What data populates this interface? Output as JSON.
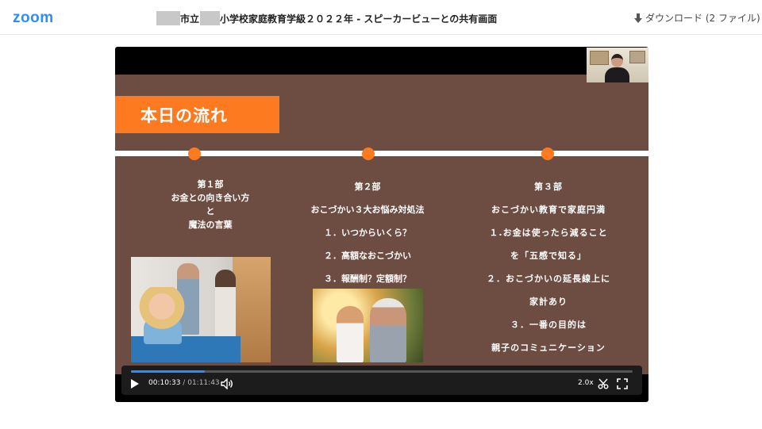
{
  "header": {
    "logo": "zoom",
    "title_part1": "市立",
    "title_part2": "小学校家庭教育学級２０２２年 - スピーカービューとの共有画面",
    "download_label": "ダウンロード (2 ファイル)",
    "download_icon": "download-arrow-icon"
  },
  "slide": {
    "title": "本日の流れ",
    "columns": [
      {
        "lines": [
          "第１部",
          "お金との向き合い方",
          "と",
          "魔法の言葉"
        ]
      },
      {
        "lines": [
          "第２部",
          "おこづかい３大お悩み対処法",
          "１．いつからいくら？",
          "２．高額なおこづかい",
          "３．報酬制？定額制？"
        ]
      },
      {
        "lines": [
          "第３部",
          "おこづかい教育で家庭円満",
          "１.お金は使ったら減ること",
          "を「五感で知る」",
          "２．おこづかいの延長線上に",
          "家計あり",
          "３．一番の目的は",
          "親子のコミュニケーション"
        ]
      }
    ],
    "accent_color": "#fe7a20",
    "background_color": "#6d4c42"
  },
  "player": {
    "current_time": "00:10:33",
    "separator": "/",
    "duration": "01:11:43",
    "progress_fraction": 0.147,
    "speed": "2.0x",
    "icons": {
      "play": "play-icon",
      "volume": "volume-icon",
      "trim": "scissors-icon",
      "fullscreen": "fullscreen-icon"
    },
    "accent_color": "#2d8cff"
  }
}
